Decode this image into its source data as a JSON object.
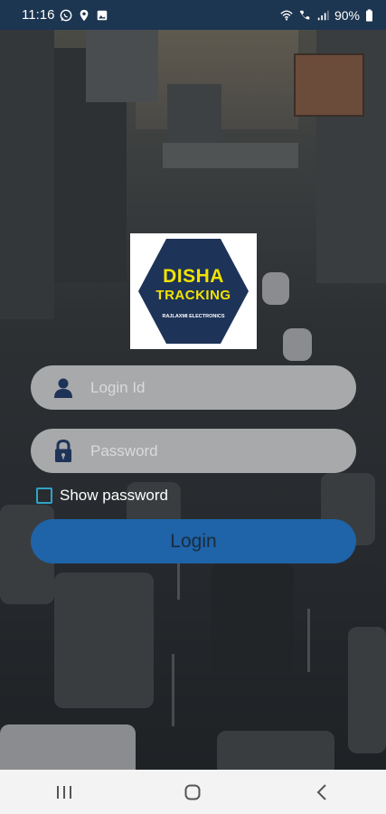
{
  "status_bar": {
    "time": "11:16",
    "battery": "90%",
    "icons_left": [
      "whatsapp-icon",
      "location-icon",
      "gallery-icon"
    ],
    "icons_right": [
      "wifi-icon",
      "call-icon",
      "signal-icon",
      "battery-icon"
    ]
  },
  "logo": {
    "title_line1": "DISHA",
    "title_line2": "TRACKING",
    "subtitle": "RAJLAXMI ELECTRONICS",
    "hex_color": "#1e3358",
    "text_color": "#f2e300"
  },
  "form": {
    "login_placeholder": "Login Id",
    "password_placeholder": "Password",
    "show_password_label": "Show password",
    "show_password_checked": false,
    "login_button": "Login"
  },
  "colors": {
    "status_bar": "#1c3550",
    "button": "#1f63a8",
    "field": "#a7a9ab",
    "checkbox": "#30a3c9"
  },
  "nav_bar": {
    "buttons": [
      "recents-icon",
      "home-icon",
      "back-icon"
    ]
  }
}
